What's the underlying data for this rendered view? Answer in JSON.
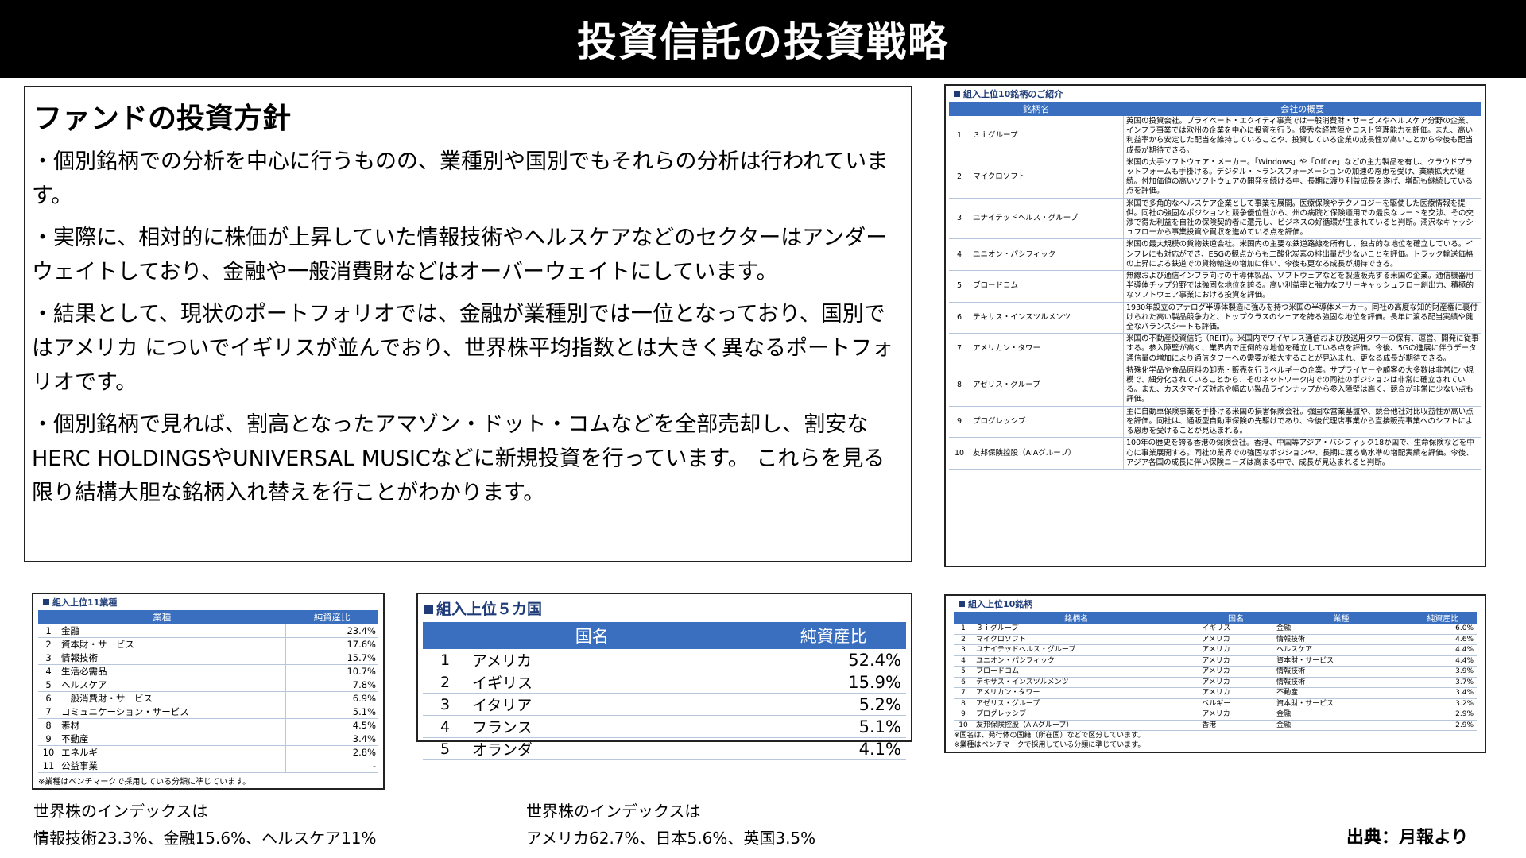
{
  "header": {
    "title": "投資信託の投資戦略"
  },
  "policy": {
    "heading": "ファンドの投資方針",
    "paragraphs": [
      "・個別銘柄での分析を中心に行うものの、業種別や国別でもそれらの分析は行われています。",
      "・実際に、相対的に株価が上昇していた情報技術やヘルスケアなどのセクターはアンダーウェイトしており、金融や一般消費財などはオーバーウェイトにしています。",
      "・結果として、現状のポートフォリオでは、金融が業種別では一位となっており、国別ではアメリカ についでイギリスが並んでおり、世界株平均指数とは大きく異なるポートフォリオです。",
      "・個別銘柄で見れば、割高となったアマゾン・ドット・コムなどを全部売却し、割安なHERC HOLDINGSやUNIVERSAL MUSICなどに新規投資を行っています。 これらを見る限り結構大胆な銘柄入れ替えを行ことがわかります。"
    ]
  },
  "top10_intro": {
    "title": "組入上位10銘柄のご紹介",
    "headers": [
      "銘柄名",
      "会社の概要"
    ],
    "rows": [
      {
        "no": "1",
        "name": "３ｉグループ",
        "desc": "英国の投資会社。プライベート・エクイティ事業では一般消費財・サービスやヘルスケア分野の企業、インフラ事業では欧州の企業を中心に投資を行う。優秀な経営陣やコスト管理能力を評価。また、高い利益率から安定した配当を維持していることや、投資している企業の成長性が高いことから今後も配当成長が期待できる。"
      },
      {
        "no": "2",
        "name": "マイクロソフト",
        "desc": "米国の大手ソフトウェア・メーカー。「Windows」や「Office」などの主力製品を有し、クラウドプラットフォームも手掛ける。デジタル・トランスフォーメーションの加速の恩恵を受け、業績拡大が継続。付加価値の高いソフトウェアの開発を続ける中、長期に渡り利益成長を遂げ、増配も継続している点を評価。"
      },
      {
        "no": "3",
        "name": "ユナイテッドヘルス・グループ",
        "desc": "米国で多角的なヘルスケア企業として事業を展開。医療保険やテクノロジーを駆使した医療情報を提供。同社の強固なポジションと競争優位性から、州の病院と保険適用での最良なレートを交渉、その交渉で得た利益を自社の保険契約者に還元し、ビジネスの好循環が生まれていると判断。潤沢なキャッシュフローから事業投資や買収を進めている点を評価。"
      },
      {
        "no": "4",
        "name": "ユニオン・パシフィック",
        "desc": "米国の最大規模の貨物鉄道会社。米国内の主要な鉄道路線を所有し、独占的な地位を確立している。インフレにも対応ができ、ESGの観点からも二酸化炭素の排出量が少ないことを評価。トラック輸送価格の上昇による鉄道での貨物輸送の増加に伴い、今後も更なる成長が期待できる。"
      },
      {
        "no": "5",
        "name": "ブロードコム",
        "desc": "無線および通信インフラ向けの半導体製品、ソフトウェアなどを製造販売する米国の企業。通信機器用半導体チップ分野では強固な地位を誇る。高い利益率と強力なフリーキャッシュフロー創出力、積極的なソフトウェア事業における投資を評価。"
      },
      {
        "no": "6",
        "name": "テキサス・インスツルメンツ",
        "desc": "1930年設立のアナログ半導体製造に強みを持つ米国の半導体メーカー。同社の高度な知的財産権に裏付けられた高い製品競争力と、トップクラスのシェアを誇る強固な地位を評価。長年に渡る配当実績や健全なバランスシートも評価。"
      },
      {
        "no": "7",
        "name": "アメリカン・タワー",
        "desc": "米国の不動産投資信託（REIT）。米国内でワイヤレス通信および放送用タワーの保有、運営、開発に従事する。参入障壁が高く、業界内で圧倒的な地位を確立している点を評価。今後、5Gの進展に伴うデータ通信量の増加により通信タワーへの需要が拡大することが見込まれ、更なる成長が期待できる。"
      },
      {
        "no": "8",
        "name": "アゼリス・グループ",
        "desc": "特殊化学品や食品原料の卸売・販売を行うベルギーの企業。サプライヤーや顧客の大多数は非常に小規模で、細分化されていることから、そのネットワーク内での同社のポジションは非常に確立されている。また、カスタマイズ対応や幅広い製品ラインナップから参入障壁は高く、競合が非常に少ない点も評価。"
      },
      {
        "no": "9",
        "name": "プログレッシブ",
        "desc": "主に自動車保険事業を手掛ける米国の損害保険会社。強固な営業基盤や、競合他社対比収益性が高い点を評価。同社は、通販型自動車保険の先駆けであり、今後代理店事業から直接販売事業へのシフトによる恩恵を受けることが見込まれる。"
      },
      {
        "no": "10",
        "name": "友邦保険控股（AIAグループ）",
        "desc": "100年の歴史を誇る香港の保険会社。香港、中国等アジア・パシフィック18か国で、生命保険などを中心に事業展開する。同社の業界での強固なポジションや、長期に渡る高水準の増配実績を評価。今後、アジア各国の成長に伴い保険ニーズは高まる中で、成長が見込まれると判断。"
      }
    ]
  },
  "sectors": {
    "title": "組入上位11業種",
    "headers": [
      "業種",
      "純資産比"
    ],
    "rows": [
      {
        "no": "1",
        "name": "金融",
        "value": "23.4%"
      },
      {
        "no": "2",
        "name": "資本財・サービス",
        "value": "17.6%"
      },
      {
        "no": "3",
        "name": "情報技術",
        "value": "15.7%"
      },
      {
        "no": "4",
        "name": "生活必需品",
        "value": "10.7%"
      },
      {
        "no": "5",
        "name": "ヘルスケア",
        "value": "7.8%"
      },
      {
        "no": "6",
        "name": "一般消費財・サービス",
        "value": "6.9%"
      },
      {
        "no": "7",
        "name": "コミュニケーション・サービス",
        "value": "5.1%"
      },
      {
        "no": "8",
        "name": "素材",
        "value": "4.5%"
      },
      {
        "no": "9",
        "name": "不動産",
        "value": "3.4%"
      },
      {
        "no": "10",
        "name": "エネルギー",
        "value": "2.8%"
      },
      {
        "no": "11",
        "name": "公益事業",
        "value": "-"
      }
    ],
    "note": "※業種はベンチマークで採用している分類に準じています。"
  },
  "countries": {
    "title": "組入上位５カ国",
    "headers": [
      "国名",
      "純資産比"
    ],
    "rows": [
      {
        "no": "1",
        "name": "アメリカ",
        "value": "52.4%"
      },
      {
        "no": "2",
        "name": "イギリス",
        "value": "15.9%"
      },
      {
        "no": "3",
        "name": "イタリア",
        "value": "5.2%"
      },
      {
        "no": "4",
        "name": "フランス",
        "value": "5.1%"
      },
      {
        "no": "5",
        "name": "オランダ",
        "value": "4.1%"
      }
    ]
  },
  "top10_summary": {
    "title": "組入上位10銘柄",
    "headers": [
      "銘柄名",
      "国名",
      "業種",
      "純資産比"
    ],
    "rows": [
      {
        "no": "1",
        "name": "３ｉグループ",
        "country": "イギリス",
        "sector": "金融",
        "value": "6.0%"
      },
      {
        "no": "2",
        "name": "マイクロソフト",
        "country": "アメリカ",
        "sector": "情報技術",
        "value": "4.6%"
      },
      {
        "no": "3",
        "name": "ユナイテッドヘルス・グループ",
        "country": "アメリカ",
        "sector": "ヘルスケア",
        "value": "4.4%"
      },
      {
        "no": "4",
        "name": "ユニオン・パシフィック",
        "country": "アメリカ",
        "sector": "資本財・サービス",
        "value": "4.4%"
      },
      {
        "no": "5",
        "name": "ブロードコム",
        "country": "アメリカ",
        "sector": "情報技術",
        "value": "3.9%"
      },
      {
        "no": "6",
        "name": "テキサス・インスツルメンツ",
        "country": "アメリカ",
        "sector": "情報技術",
        "value": "3.7%"
      },
      {
        "no": "7",
        "name": "アメリカン・タワー",
        "country": "アメリカ",
        "sector": "不動産",
        "value": "3.4%"
      },
      {
        "no": "8",
        "name": "アゼリス・グループ",
        "country": "ベルギー",
        "sector": "資本財・サービス",
        "value": "3.2%"
      },
      {
        "no": "9",
        "name": "プログレッシブ",
        "country": "アメリカ",
        "sector": "金融",
        "value": "2.9%"
      },
      {
        "no": "10",
        "name": "友邦保険控股（AIAグループ）",
        "country": "香港",
        "sector": "金融",
        "value": "2.9%"
      }
    ],
    "notes": [
      "※国名は、発行体の国籍（所在国）などで区分しています。",
      "※業種はベンチマークで採用している分類に準じています。"
    ]
  },
  "captions": {
    "sector_line1": "世界株のインデックスは",
    "sector_line2": "情報技術23.3%、金融15.6%、ヘルスケア11%",
    "country_line1": "世界株のインデックスは",
    "country_line2": "アメリカ62.7%、日本5.6%、英国3.5%"
  },
  "source": "出典：月報より",
  "colors": {
    "header_bg": "#000000",
    "table_header": "#3a6fbf",
    "title_blue": "#1f3c78"
  }
}
